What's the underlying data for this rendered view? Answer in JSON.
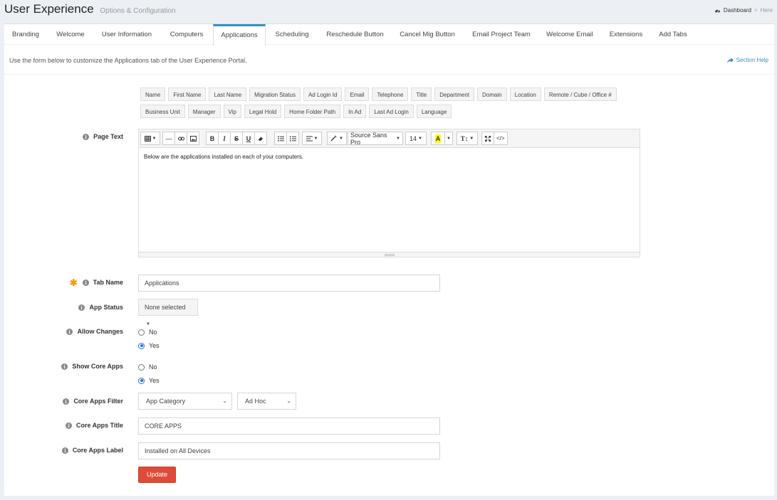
{
  "header": {
    "title": "User Experience",
    "subtitle": "Options & Configuration",
    "breadcrumb": {
      "home": "Dashboard",
      "separator": ">",
      "current": "Here"
    }
  },
  "tabs": [
    {
      "label": "Branding"
    },
    {
      "label": "Welcome"
    },
    {
      "label": "User Information"
    },
    {
      "label": "Computers"
    },
    {
      "label": "Applications",
      "active": true
    },
    {
      "label": "Scheduling"
    },
    {
      "label": "Reschedule Button"
    },
    {
      "label": "Cancel Mig Button"
    },
    {
      "label": "Email Project Team"
    },
    {
      "label": "Welcome Email"
    },
    {
      "label": "Extensions"
    },
    {
      "label": "Add Tabs"
    }
  ],
  "intro": "Use the form below to customize the Applications tab of the User Experience Portal.",
  "section_help": "Section Help",
  "tokens": {
    "row1": [
      "Name",
      "First Name",
      "Last Name",
      "Migration Status",
      "Ad Login Id",
      "Email",
      "Telephone",
      "Title",
      "Department",
      "Domain",
      "Location",
      "Remote / Cube / Office #"
    ],
    "row2": [
      "Business Unit",
      "Manager",
      "Vip",
      "Legal Hold",
      "Home Folder Path",
      "In Ad",
      "Last Ad Login",
      "Language"
    ]
  },
  "editor": {
    "label": "Page Text",
    "font_family": "Source Sans Pro",
    "font_size": "14",
    "content": "Below are the applications installed on each of your computers."
  },
  "form": {
    "tab_name": {
      "label": "Tab Name",
      "value": "Applications",
      "required": true
    },
    "app_status": {
      "label": "App Status",
      "value": "None selected"
    },
    "allow_changes": {
      "label": "Allow Changes",
      "options": [
        "No",
        "Yes"
      ],
      "selected": "Yes"
    },
    "show_core_apps": {
      "label": "Show Core Apps",
      "options": [
        "No",
        "Yes"
      ],
      "selected": "Yes"
    },
    "core_apps_filter": {
      "label": "Core Apps Filter",
      "category": "App Category",
      "type": "Ad Hoc"
    },
    "core_apps_title": {
      "label": "Core Apps Title",
      "value": "CORE APPS"
    },
    "core_apps_label": {
      "label": "Core Apps Label",
      "value": "Installed on All Devices"
    },
    "update_label": "Update"
  },
  "colors": {
    "accent": "#3c8dbc",
    "danger": "#dd4b39",
    "required": "#f39c12",
    "radio": "#1a73e8"
  }
}
